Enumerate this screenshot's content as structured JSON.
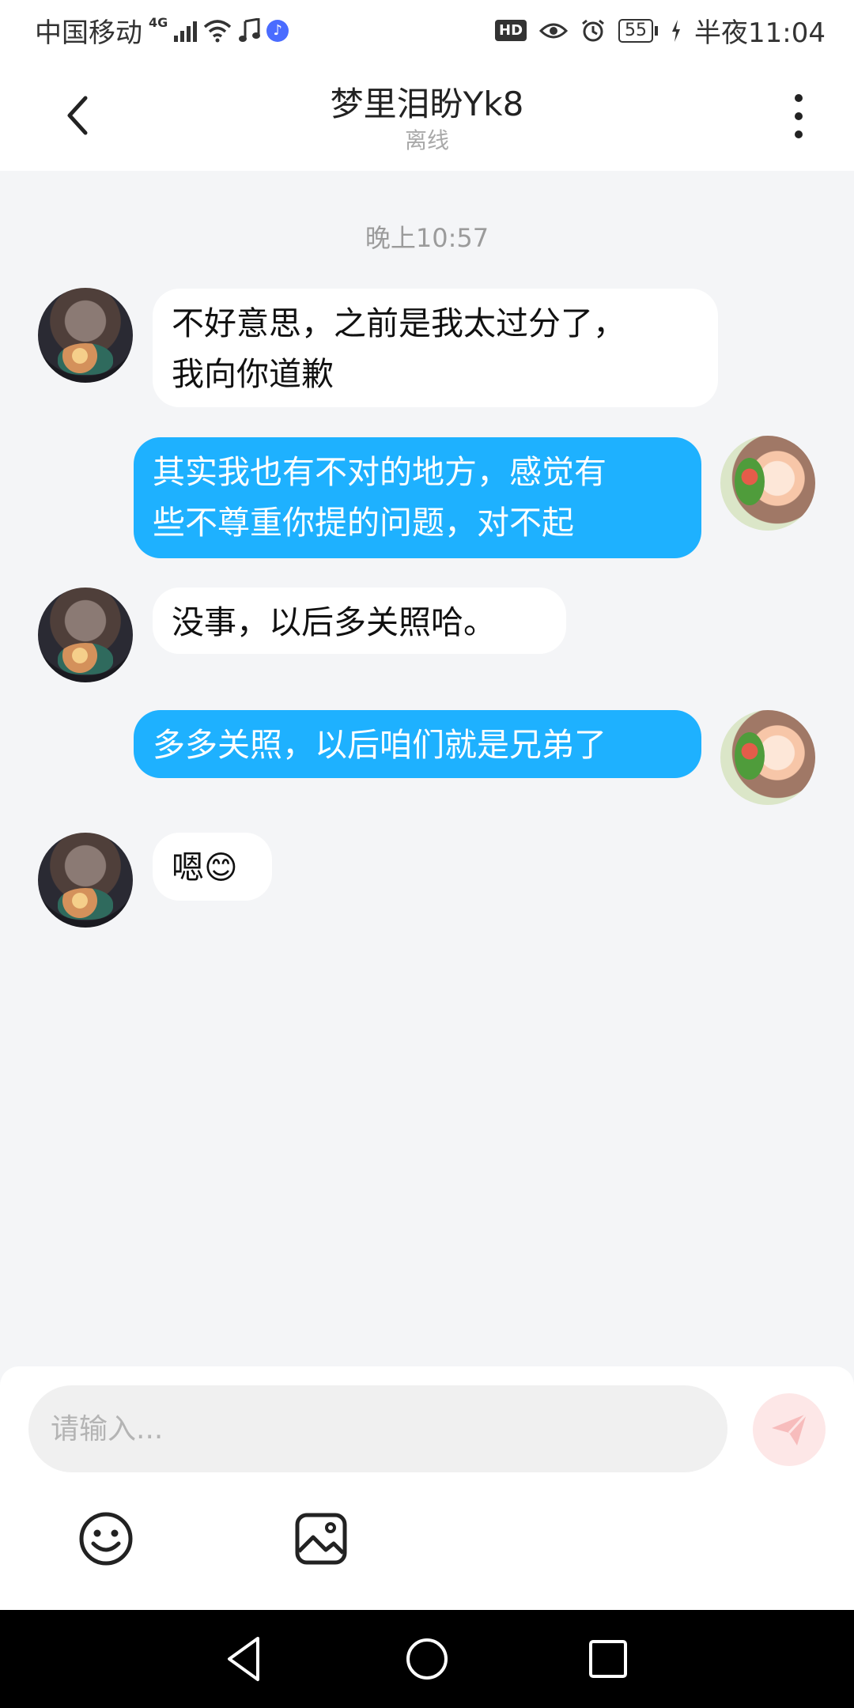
{
  "status_bar": {
    "carrier": "中国移动",
    "network": "4G",
    "battery": "55",
    "time": "半夜11:04",
    "icons": [
      "signal-icon",
      "wifi-icon",
      "music-note-icon",
      "music-app-icon",
      "hd-icon",
      "eye-icon",
      "alarm-icon",
      "battery-icon",
      "charging-icon"
    ]
  },
  "header": {
    "title": "梦里泪盼Yk8",
    "status": "离线",
    "icons": [
      "back-icon",
      "more-icon"
    ]
  },
  "chat": {
    "timestamp": "晚上10:57",
    "messages": [
      {
        "from": "other",
        "text_lines": [
          "不好意思，之前是我太过分了，",
          "我向你道歉"
        ]
      },
      {
        "from": "me",
        "text_lines": [
          "其实我也有不对的地方，感觉有",
          "些不尊重你提的问题，对不起"
        ]
      },
      {
        "from": "other",
        "text_lines": [
          "没事，以后多关照哈。"
        ]
      },
      {
        "from": "me",
        "text_lines": [
          "多多关照，以后咱们就是兄弟了"
        ]
      },
      {
        "from": "other",
        "text_lines": [
          "嗯😊"
        ]
      }
    ]
  },
  "input": {
    "placeholder": "请输入...",
    "value": "",
    "icons": [
      "send-icon",
      "emoji-icon",
      "image-icon"
    ]
  },
  "colors": {
    "accent": "#1eb1ff",
    "background": "#f4f5f7",
    "incoming_bubble": "#ffffff",
    "send_disabled": "#fde7e7"
  },
  "navbar": {
    "icons": [
      "nav-back-icon",
      "nav-home-icon",
      "nav-recents-icon"
    ]
  }
}
